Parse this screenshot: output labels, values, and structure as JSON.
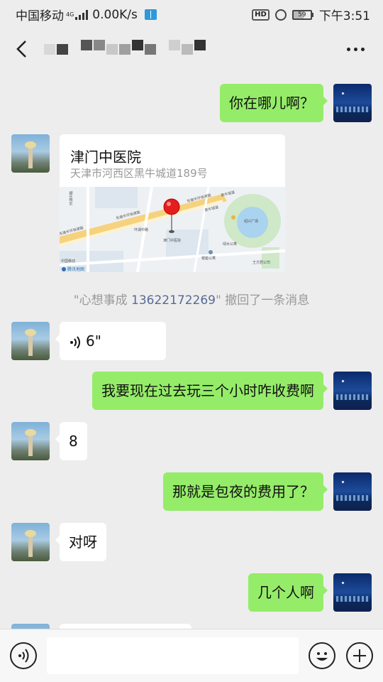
{
  "status_bar": {
    "carrier": "中国移动",
    "network": "4G",
    "speed": "0.00K/s",
    "hd_label": "HD",
    "battery": "59",
    "time": "下午3:51"
  },
  "nav": {
    "back_icon": "chevron-left-icon",
    "more_icon": "more-dots-icon",
    "title_obscured": true
  },
  "messages": [
    {
      "from": "self",
      "type": "text",
      "text": "你在哪儿啊？"
    },
    {
      "from": "other",
      "type": "location",
      "name": "津门中医院",
      "address": "天津市河西区黑牛城道189号",
      "map_labels": {
        "road_1": "东南半环快速路",
        "road_2": "东南半环快速路",
        "road_3": "东南半环快速路",
        "road_4": "黑牛城道",
        "road_5": "黑牛城道",
        "road_6": "环湖中路",
        "road_7": "环湖中路",
        "poi_1": "津门中医院",
        "poi_2": "绍兴广场",
        "poi_3": "绿水公寓",
        "poi_4": "银座公寓",
        "poi_5": "王方居公司",
        "poi_6": "腾讯地图",
        "poi_7": "中国移动"
      }
    },
    {
      "type": "recall",
      "prefix": "\"心想事成 ",
      "phone": "13622172269",
      "suffix": "\" 撤回了一条消息"
    },
    {
      "from": "other",
      "type": "voice",
      "duration": "6\""
    },
    {
      "from": "self",
      "type": "text",
      "text": "我要现在过去玩三个小时咋收费啊"
    },
    {
      "from": "other",
      "type": "text",
      "text": "8"
    },
    {
      "from": "self",
      "type": "text",
      "text": "那就是包夜的费用了？"
    },
    {
      "from": "other",
      "type": "text",
      "text": "对呀"
    },
    {
      "from": "self",
      "type": "text",
      "text": "几个人啊"
    }
  ],
  "input_bar": {
    "placeholder": "",
    "voice_icon": "voice-input-icon",
    "emoji_icon": "emoji-icon",
    "plus_icon": "plus-icon"
  },
  "colors": {
    "background": "#ededed",
    "self_bubble": "#95ec69",
    "other_bubble": "#ffffff",
    "link": "#576b95"
  }
}
